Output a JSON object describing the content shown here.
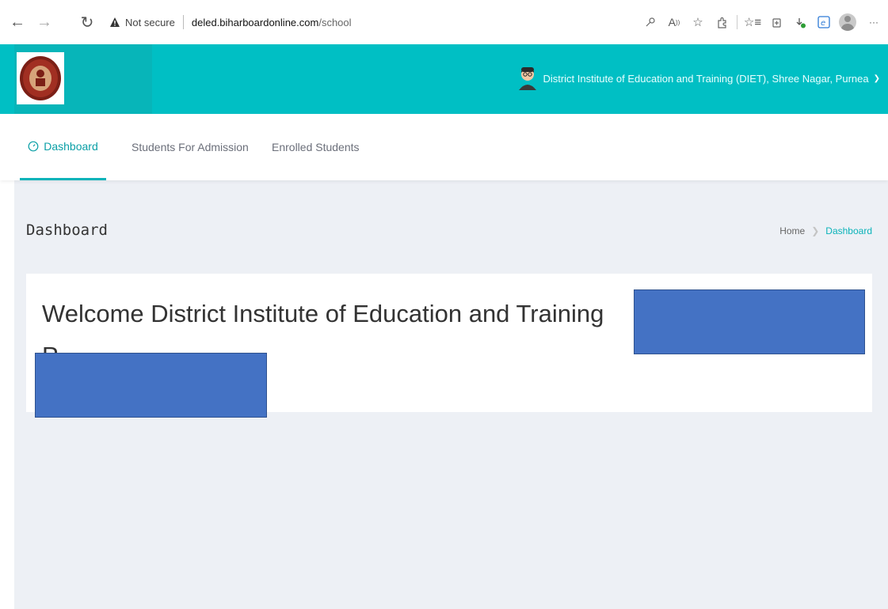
{
  "browser": {
    "not_secure": "Not secure",
    "url_host": "deled.biharboardonline.com",
    "url_path": "/school",
    "more": "···"
  },
  "header": {
    "user_name": "District Institute of Education and Training (DIET), Shree Nagar, Purnea",
    "background_color": "#00bfc4"
  },
  "tabs": [
    {
      "label": "Dashboard",
      "active": true
    },
    {
      "label": "Students For Admission",
      "active": false
    },
    {
      "label": "Enrolled Students",
      "active": false
    }
  ],
  "page": {
    "title": "Dashboard",
    "breadcrumb": {
      "home": "Home",
      "current": "Dashboard"
    },
    "welcome_text": "Welcome District Institute of Education and Training",
    "welcome_overflow_glyph": "P"
  },
  "icons": {
    "back": "arrow-left-icon",
    "forward": "arrow-right-icon",
    "reload": "refresh-icon",
    "warning": "warning-triangle-icon",
    "dashboard": "gauge-icon"
  },
  "colors": {
    "accent": "#0ab3b9",
    "redaction": "#4472c4"
  }
}
